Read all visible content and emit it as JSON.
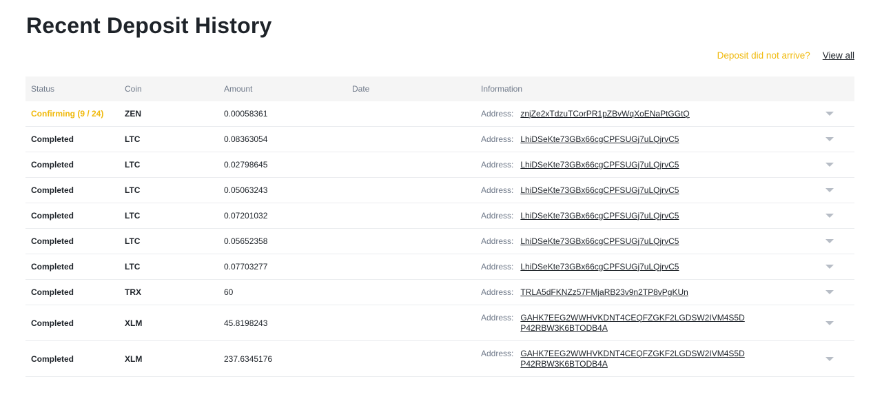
{
  "page": {
    "title": "Recent Deposit History",
    "not_arrived_link": "Deposit did not arrive?",
    "view_all_link": "View all",
    "accent_color": "#f0b90b"
  },
  "table": {
    "headers": {
      "status": "Status",
      "coin": "Coin",
      "amount": "Amount",
      "date": "Date",
      "information": "Information"
    },
    "address_label": "Address:",
    "rows": [
      {
        "status": "Confirming (9 / 24)",
        "coin": "ZEN",
        "amount": "0.00058361",
        "date": "",
        "address": "znjZe2xTdzuTCorPR1pZBvWqXoENaPtGGtQ"
      },
      {
        "status": "Completed",
        "coin": "LTC",
        "amount": "0.08363054",
        "date": "",
        "address": "LhiDSeKte73GBx66cgCPFSUGj7uLQjrvC5"
      },
      {
        "status": "Completed",
        "coin": "LTC",
        "amount": "0.02798645",
        "date": "",
        "address": "LhiDSeKte73GBx66cgCPFSUGj7uLQjrvC5"
      },
      {
        "status": "Completed",
        "coin": "LTC",
        "amount": "0.05063243",
        "date": "",
        "address": "LhiDSeKte73GBx66cgCPFSUGj7uLQjrvC5"
      },
      {
        "status": "Completed",
        "coin": "LTC",
        "amount": "0.07201032",
        "date": "",
        "address": "LhiDSeKte73GBx66cgCPFSUGj7uLQjrvC5"
      },
      {
        "status": "Completed",
        "coin": "LTC",
        "amount": "0.05652358",
        "date": "",
        "address": "LhiDSeKte73GBx66cgCPFSUGj7uLQjrvC5"
      },
      {
        "status": "Completed",
        "coin": "LTC",
        "amount": "0.07703277",
        "date": "",
        "address": "LhiDSeKte73GBx66cgCPFSUGj7uLQjrvC5"
      },
      {
        "status": "Completed",
        "coin": "TRX",
        "amount": "60",
        "date": "",
        "address": "TRLA5dFKNZz57FMjaRB23v9n2TP8vPgKUn"
      },
      {
        "status": "Completed",
        "coin": "XLM",
        "amount": "45.8198243",
        "date": "",
        "address": "GAHK7EEG2WWHVKDNT4CEQFZGKF2LGDSW2IVM4S5DP42RBW3K6BTODB4A"
      },
      {
        "status": "Completed",
        "coin": "XLM",
        "amount": "237.6345176",
        "date": "",
        "address": "GAHK7EEG2WWHVKDNT4CEQFZGKF2LGDSW2IVM4S5DP42RBW3K6BTODB4A"
      }
    ]
  }
}
